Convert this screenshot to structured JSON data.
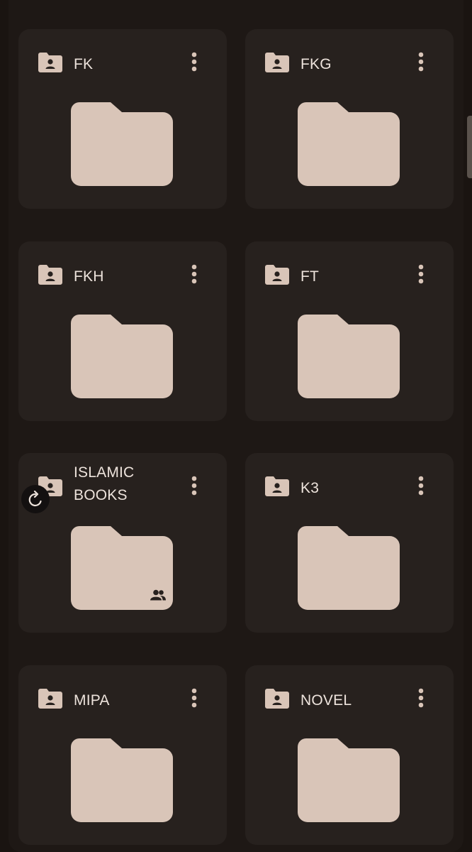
{
  "folders": [
    {
      "name": "FK",
      "shared": false
    },
    {
      "name": "FKG",
      "shared": false
    },
    {
      "name": "FKH",
      "shared": false
    },
    {
      "name": "FT",
      "shared": false
    },
    {
      "name": "ISLAMIC BOOKS",
      "shared": true
    },
    {
      "name": "K3",
      "shared": false
    },
    {
      "name": "MIPA",
      "shared": false
    },
    {
      "name": "NOVEL",
      "shared": false
    }
  ],
  "icons": {
    "header": "shared-folder-icon",
    "menu": "more-vert-icon",
    "preview": "folder-icon",
    "shared": "people-icon",
    "refresh": "refresh-icon"
  },
  "colors": {
    "background": "#1a1411",
    "card": "#27211e",
    "accent": "#d9c5b8",
    "text": "#ede3dc"
  }
}
